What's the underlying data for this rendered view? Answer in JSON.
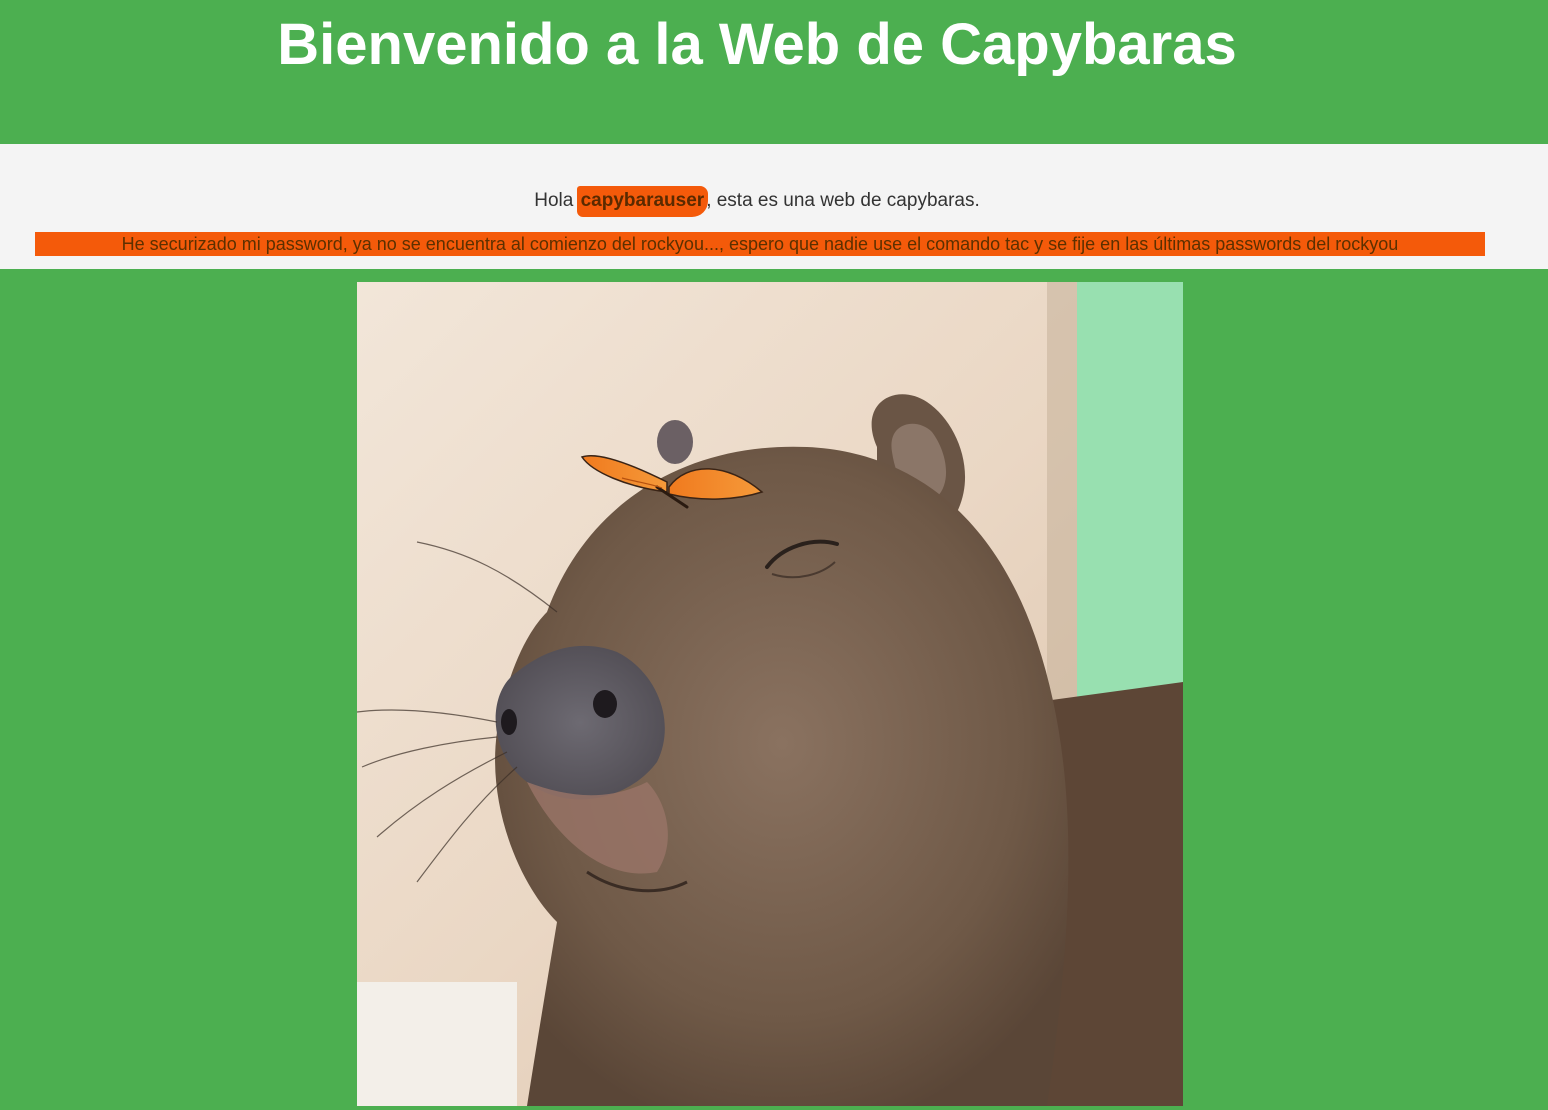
{
  "header": {
    "title": "Bienvenido a la Web de Capybaras"
  },
  "greeting": {
    "prefix": "Hola ",
    "username": "capybarauser",
    "suffix": ", esta es una web de capybaras."
  },
  "notice": {
    "text": "He securizado mi password, ya no se encuentra al comienzo del rockyou..., espero que nadie use el comando tac y se fije en las últimas passwords del rockyou"
  },
  "image": {
    "subject": "capybara-with-butterfly"
  },
  "colors": {
    "page_green": "#4caf50",
    "banner_bg": "#f4f4f4",
    "highlight_orange": "#f45a0a",
    "title_text": "#ffffff"
  }
}
